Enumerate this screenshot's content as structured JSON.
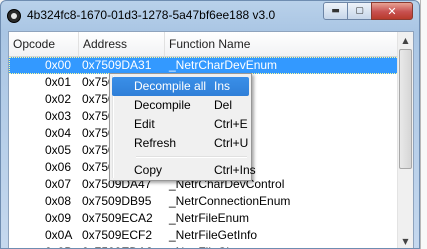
{
  "window": {
    "title": "4b324fc8-1670-01d3-1278-5a47bf6ee188 v3.0",
    "buttons": {
      "minimize": "▬",
      "maximize": "▢",
      "close": "✕"
    }
  },
  "table": {
    "columns": [
      "Opcode",
      "Address",
      "Function Name"
    ],
    "rows": [
      {
        "opcode": "0x00",
        "address": "0x7509DA31",
        "name": "_NetrCharDevEnum",
        "selected": true
      },
      {
        "opcode": "0x01",
        "address": "0x750",
        "name": "Info"
      },
      {
        "opcode": "0x02",
        "address": "0x750",
        "name": "ontrol"
      },
      {
        "opcode": "0x03",
        "address": "0x750",
        "name": "um"
      },
      {
        "opcode": "0x04",
        "address": "0x750",
        "name": "um"
      },
      {
        "opcode": "0x05",
        "address": "0x750",
        "name": "um"
      },
      {
        "opcode": "0x06",
        "address": "0x750",
        "name": "urge"
      },
      {
        "opcode": "0x07",
        "address": "0x7509DA47",
        "name": "_NetrCharDevControl"
      },
      {
        "opcode": "0x08",
        "address": "0x7509DB95",
        "name": "_NetrConnectionEnum"
      },
      {
        "opcode": "0x09",
        "address": "0x7509ECA2",
        "name": "_NetrFileEnum"
      },
      {
        "opcode": "0x0A",
        "address": "0x7509ECF2",
        "name": "_NetrFileGetInfo"
      },
      {
        "opcode": "0x0B",
        "address": "0x7509EDA2",
        "name": "_NetrFileCl"
      }
    ]
  },
  "context_menu": {
    "items": [
      {
        "label": "Decompile all",
        "shortcut": "Ins",
        "highlighted": true
      },
      {
        "label": "Decompile",
        "shortcut": "Del"
      },
      {
        "label": "Edit",
        "shortcut": "Ctrl+E"
      },
      {
        "label": "Refresh",
        "shortcut": "Ctrl+U"
      },
      {
        "separator": true
      },
      {
        "label": "Copy",
        "shortcut": "Ctrl+Ins"
      }
    ]
  },
  "scrollbar": {
    "up_arrow": "▲",
    "down_arrow": "▼"
  },
  "colors": {
    "selection": "#3399ff",
    "menu_highlight": "#3a8fe8"
  }
}
